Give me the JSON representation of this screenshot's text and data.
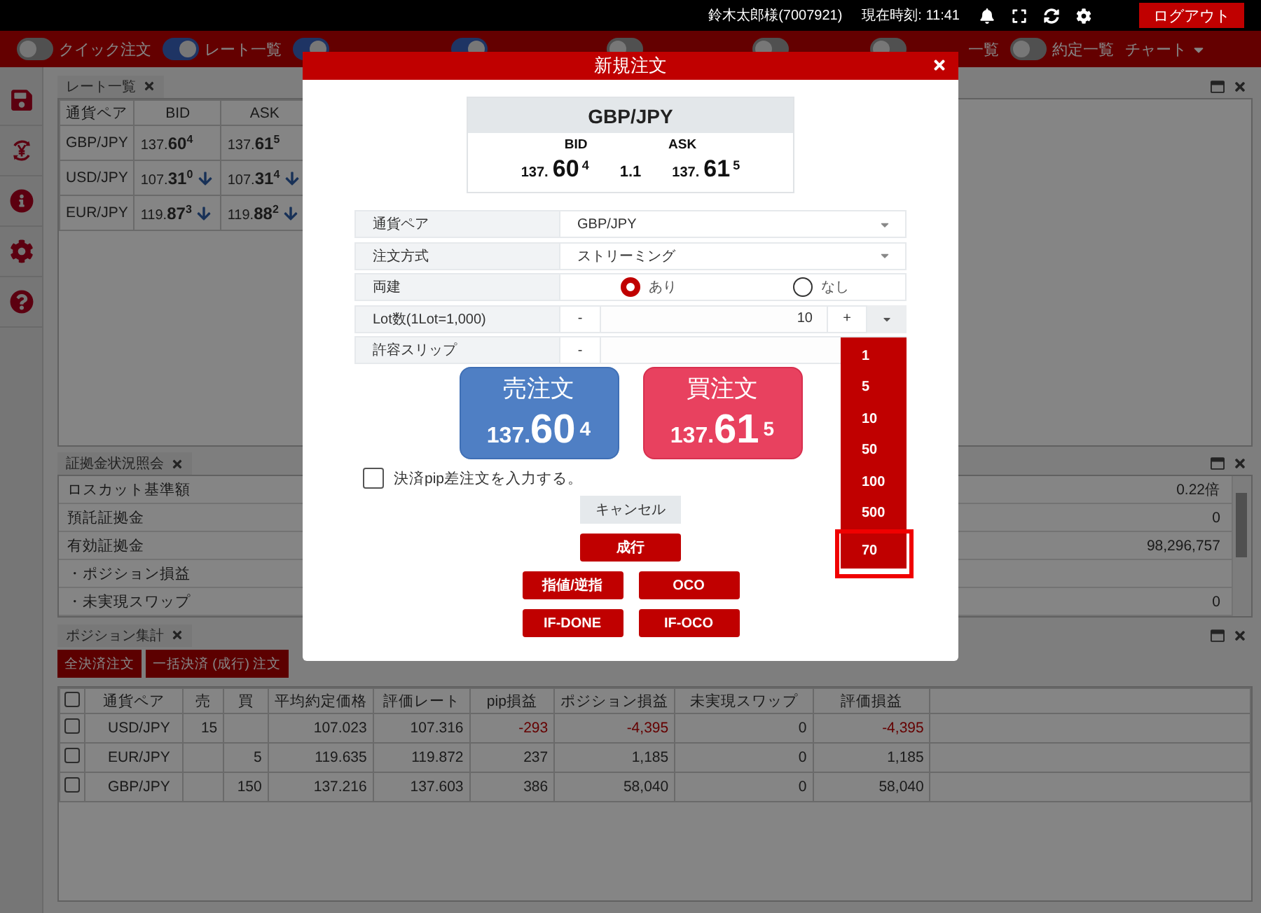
{
  "top_bar": {
    "user": "鈴木太郎様(7007921)",
    "clock": "現在時刻: 11:41",
    "logout_button": "ログアウト"
  },
  "toolbar": {
    "toggles": [
      {
        "label": "クイック注文",
        "on": false
      },
      {
        "label": "レート一覧",
        "on": true
      },
      {
        "on": true
      },
      {
        "on": true
      },
      {
        "on": false
      },
      {
        "on": false
      },
      {
        "label": "一覧",
        "on": false
      },
      {
        "label": "約定一覧",
        "on": false
      }
    ],
    "chart_menu": "チャート"
  },
  "rate_panel": {
    "title": "レート一覧",
    "columns": [
      "通貨ペア",
      "BID",
      "ASK"
    ],
    "rows": [
      {
        "pair": "GBP/JPY",
        "bid": {
          "base": "137.",
          "pips": "60",
          "frac": "4",
          "down": false
        },
        "ask": {
          "base": "137.",
          "pips": "61",
          "frac": "5",
          "down": false
        }
      },
      {
        "pair": "USD/JPY",
        "bid": {
          "base": "107.",
          "pips": "31",
          "frac": "0",
          "down": true
        },
        "ask": {
          "base": "107.",
          "pips": "31",
          "frac": "4",
          "down": true
        }
      },
      {
        "pair": "EUR/JPY",
        "bid": {
          "base": "119.",
          "pips": "87",
          "frac": "3",
          "down": true
        },
        "ask": {
          "base": "119.",
          "pips": "88",
          "frac": "2",
          "down": true
        }
      }
    ]
  },
  "margin_panel": {
    "title": "証拠金状況照会",
    "rows": [
      {
        "label": "ロスカット基準額",
        "value": "0.22倍"
      },
      {
        "label": "預託証拠金",
        "value": "0"
      },
      {
        "label": "有効証拠金",
        "value": "98,296,757"
      },
      {
        "label": "・ポジション損益"
      },
      {
        "label": "・未実現スワップ",
        "value": "0"
      }
    ]
  },
  "position_panel": {
    "title": "ポジション集計",
    "buttons": [
      "全決済注文",
      "一括決済 (成行) 注文"
    ],
    "header_checked": false,
    "columns": [
      "通貨ペア",
      "売",
      "買",
      "平均約定価格",
      "評価レート",
      "pip損益",
      "ポジション損益",
      "未実現スワップ",
      "評価損益"
    ],
    "rows": [
      {
        "checked": false,
        "loss": true,
        "pair": "USD/JPY",
        "sell": "15",
        "avg_price": "107.023",
        "rate": "107.316",
        "pip": "-293",
        "position_pl": "-4,395",
        "swap": "0",
        "valuation_pl": "-4,395"
      },
      {
        "checked": false,
        "loss": false,
        "pair": "EUR/JPY",
        "buy": "5",
        "avg_price": "119.635",
        "rate": "119.872",
        "pip": "237",
        "position_pl": "1,185",
        "swap": "0",
        "valuation_pl": "1,185"
      },
      {
        "checked": false,
        "loss": false,
        "pair": "GBP/JPY",
        "buy": "150",
        "avg_price": "137.216",
        "rate": "137.603",
        "pip": "386",
        "position_pl": "58,040",
        "swap": "0",
        "valuation_pl": "58,040"
      }
    ]
  },
  "modal": {
    "title": "新規注文",
    "quote": {
      "pair": "GBP/JPY",
      "bid_label": "BID",
      "ask_label": "ASK",
      "bid": {
        "base": "137.",
        "pips": "60",
        "frac": "4"
      },
      "spread": "1.1",
      "ask": {
        "base": "137.",
        "pips": "61",
        "frac": "5"
      }
    },
    "form": [
      {
        "kind": "select",
        "label": "通貨ペア",
        "value": "GBP/JPY"
      },
      {
        "kind": "select",
        "label": "注文方式",
        "value": "ストリーミング"
      },
      {
        "kind": "radio",
        "label": "両建",
        "options": [
          {
            "label": "あり",
            "selected": true
          },
          {
            "label": "なし",
            "selected": false
          }
        ]
      },
      {
        "kind": "stepper",
        "label": "Lot数(1Lot=1,000)",
        "minus": "-",
        "value": "10",
        "plus": "+",
        "dropdown": true
      },
      {
        "kind": "stepper",
        "label": "許容スリップ",
        "minus": "-"
      }
    ],
    "lot_dropdown": [
      {
        "label": "1",
        "selected": false
      },
      {
        "label": "5",
        "selected": false
      },
      {
        "label": "10",
        "selected": false
      },
      {
        "label": "50",
        "selected": false
      },
      {
        "label": "100",
        "selected": false
      },
      {
        "label": "500",
        "selected": false
      },
      {
        "label": "70",
        "selected": true
      }
    ],
    "trade_buttons": [
      {
        "kind": "sell",
        "label": "売注文",
        "price": {
          "base": "137.",
          "pips": "60",
          "frac": "4"
        }
      },
      {
        "kind": "buy",
        "label": "買注文",
        "price": {
          "base": "137.",
          "pips": "61",
          "frac": "5"
        }
      }
    ],
    "pip_checkbox": {
      "label": "決済pip差注文を入力する。",
      "checked": false
    },
    "cancel_button": "キャンセル",
    "order_buttons": [
      [
        "成行"
      ],
      [
        "指値/逆指",
        "OCO"
      ],
      [
        "IF-DONE",
        "IF-OCO"
      ]
    ]
  }
}
